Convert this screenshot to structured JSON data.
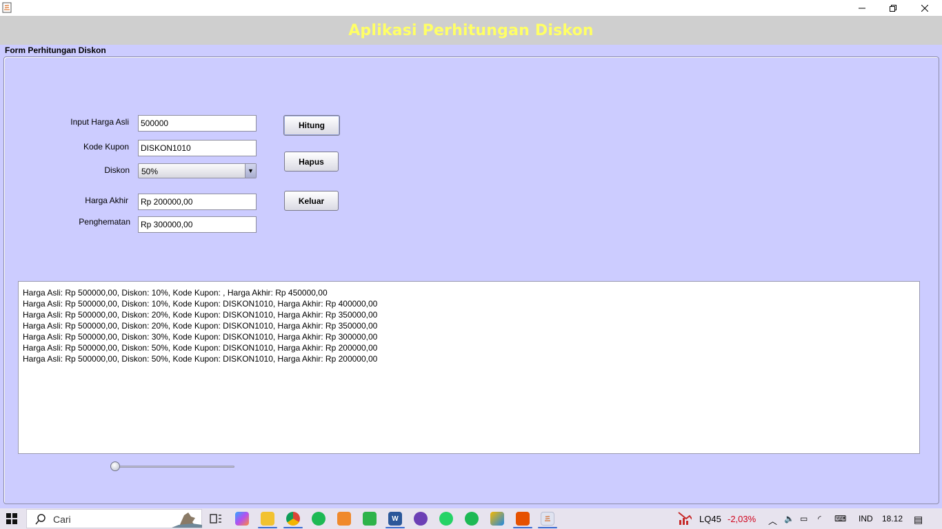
{
  "header": {
    "title": "Aplikasi Perhitungan Diskon"
  },
  "panel": {
    "title": "Form Perhitungan Diskon"
  },
  "form": {
    "harga_asli_label": "Input Harga Asli",
    "harga_asli_value": "500000",
    "kupon_label": "Kode Kupon",
    "kupon_value": "DISKON1010",
    "diskon_label": "Diskon",
    "diskon_selected": "50%",
    "harga_akhir_label": "Harga Akhir",
    "harga_akhir_value": "Rp 200000,00",
    "penghematan_label": "Penghematan",
    "penghematan_value": "Rp 300000,00"
  },
  "buttons": {
    "hitung": "Hitung",
    "hapus": "Hapus",
    "keluar": "Keluar"
  },
  "log": [
    "Harga Asli: Rp 500000,00, Diskon: 10%, Kode Kupon: , Harga Akhir: Rp 450000,00",
    "Harga Asli: Rp 500000,00, Diskon: 10%, Kode Kupon: DISKON1010, Harga Akhir: Rp 400000,00",
    "Harga Asli: Rp 500000,00, Diskon: 20%, Kode Kupon: DISKON1010, Harga Akhir: Rp 350000,00",
    "Harga Asli: Rp 500000,00, Diskon: 20%, Kode Kupon: DISKON1010, Harga Akhir: Rp 350000,00",
    "Harga Asli: Rp 500000,00, Diskon: 30%, Kode Kupon: DISKON1010, Harga Akhir: Rp 300000,00",
    "Harga Asli: Rp 500000,00, Diskon: 50%, Kode Kupon: DISKON1010, Harga Akhir: Rp 200000,00",
    "Harga Asli: Rp 500000,00, Diskon: 50%, Kode Kupon: DISKON1010, Harga Akhir: Rp 200000,00"
  ],
  "slider": {
    "value_fraction": 0.0
  },
  "taskbar": {
    "search_placeholder": "Cari",
    "stock_symbol": "LQ45",
    "stock_change": "-2,03%",
    "language": "IND",
    "time": "18.12"
  },
  "colors": {
    "accent_title": "#ffff66",
    "background": "#ccccff",
    "stock_negative": "#d0021b"
  }
}
